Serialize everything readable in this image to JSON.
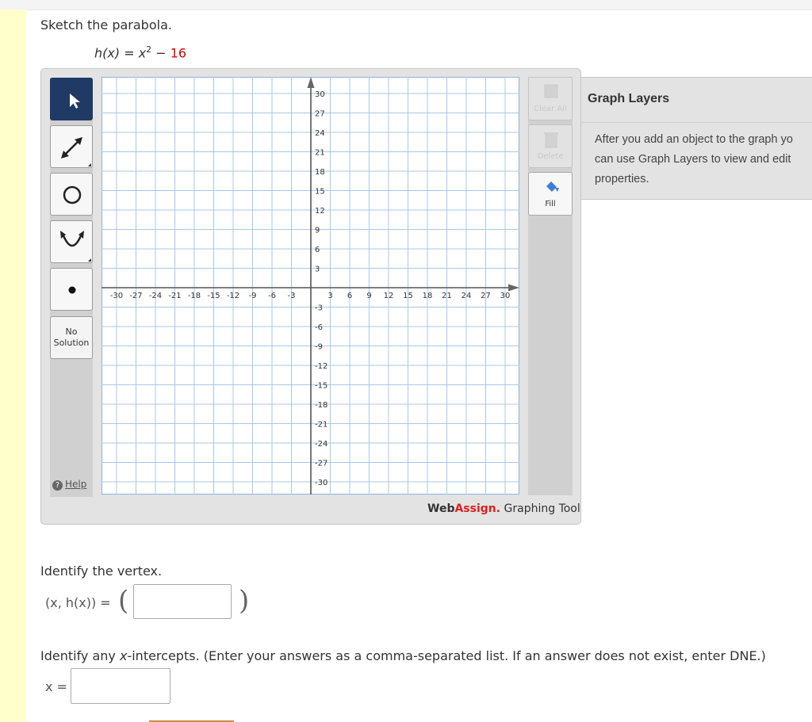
{
  "prompt": "Sketch the parabola.",
  "equation": {
    "lhs": "h(x)",
    "equals": "=",
    "base": "x",
    "exponent": "2",
    "minus": "−",
    "constant": "16"
  },
  "tools": {
    "pointer": "pointer-icon",
    "line": "line-segment-icon",
    "circle": "circle-icon",
    "parabola": "parabola-icon",
    "point": "point-icon",
    "no_solution_line1": "No",
    "no_solution_line2": "Solution",
    "help": "Help"
  },
  "graph": {
    "x_ticks": [
      "-30",
      "-27",
      "-24",
      "-21",
      "-18",
      "-15",
      "-12",
      "-9",
      "-6",
      "-3",
      "3",
      "6",
      "9",
      "12",
      "15",
      "18",
      "21",
      "24",
      "27",
      "30"
    ],
    "y_ticks": [
      "30",
      "27",
      "24",
      "21",
      "18",
      "15",
      "12",
      "9",
      "6",
      "3",
      "-3",
      "-6",
      "-9",
      "-12",
      "-15",
      "-18",
      "-21",
      "-24",
      "-27",
      "-30"
    ],
    "xlim": [
      -30,
      30
    ],
    "ylim": [
      -30,
      30
    ],
    "grid": true,
    "grid_step": 3
  },
  "right_buttons": {
    "clear_all": "Clear All",
    "delete": "Delete",
    "fill": "Fill"
  },
  "brand": {
    "web": "Web",
    "assign": "Assign.",
    "rest": " Graphing Tool"
  },
  "graph_layers": {
    "title": "Graph Layers",
    "text": "After you add an object to the graph yo\ncan use Graph Layers to view and edit\nproperties."
  },
  "q1": {
    "text": "Identify the vertex.",
    "lhs": "(x, h(x)) =",
    "open": "(",
    "close": ")",
    "value": ""
  },
  "q2": {
    "before": "Identify any ",
    "var": "x",
    "after": "-intercepts. (Enter your answers as a comma-separated list. If an answer does not exist, enter DNE.)",
    "lhs": "x =",
    "value": ""
  },
  "colors": {
    "accent_red": "#e00000",
    "active_tool": "#203a66",
    "panel": "#e3e3e3",
    "left_strip": "#ffffcc",
    "grid_line": "#a8c8e6"
  }
}
